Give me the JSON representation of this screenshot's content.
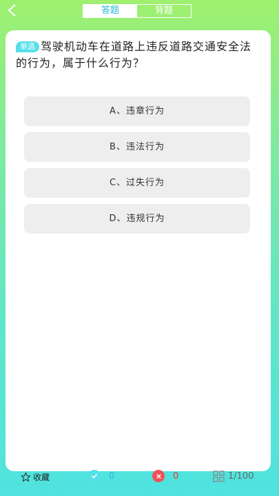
{
  "header": {
    "back_icon": "chevron-left-icon",
    "tabs": [
      {
        "label": "答题",
        "active": true
      },
      {
        "label": "背题",
        "active": false
      }
    ]
  },
  "question": {
    "type_badge": "单选",
    "text": "驾驶机动车在道路上违反道路交通安全法的行为，属于什么行为？"
  },
  "options": [
    {
      "label": "A、违章行为"
    },
    {
      "label": "B、违法行为"
    },
    {
      "label": "C、过失行为"
    },
    {
      "label": "D、违规行为"
    }
  ],
  "footer": {
    "favorite_label": "收藏",
    "favorite_icon": "star-outline-icon",
    "correct_count": "0",
    "correct_icon": "check-circle-icon",
    "wrong_count": "0",
    "wrong_icon": "x-circle-icon",
    "progress": "1/100",
    "progress_icon": "grid-icon"
  },
  "colors": {
    "accent": "#56dfe8",
    "wrong": "#f0525a",
    "gradient_top": "#9ff06e",
    "gradient_bottom": "#4fe3e0"
  }
}
